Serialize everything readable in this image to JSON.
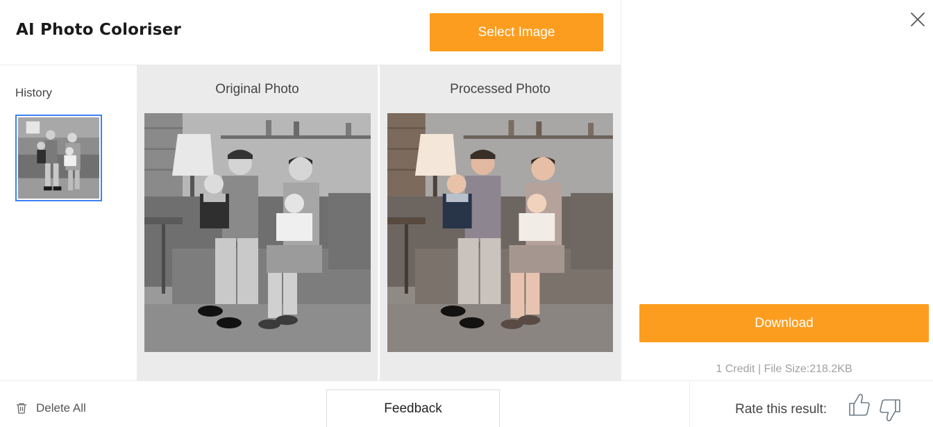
{
  "header": {
    "title": "AI Photo Coloriser",
    "select_label": "Select Image"
  },
  "history": {
    "title": "History"
  },
  "panels": {
    "original_title": "Original Photo",
    "processed_title": "Processed Photo"
  },
  "actions": {
    "download_label": "Download",
    "credit_info": "1 Credit | File Size:218.2KB"
  },
  "footer": {
    "delete_all_label": "Delete All",
    "feedback_label": "Feedback",
    "rate_label": "Rate this result:"
  },
  "icons": {
    "close": "close-icon",
    "trash": "trash-icon",
    "thumbs_up": "thumbs-up-icon",
    "thumbs_down": "thumbs-down-icon"
  },
  "colors": {
    "accent": "#fd9d1f",
    "selected_border": "#3b82f6",
    "panel_bg": "#ebebeb"
  }
}
